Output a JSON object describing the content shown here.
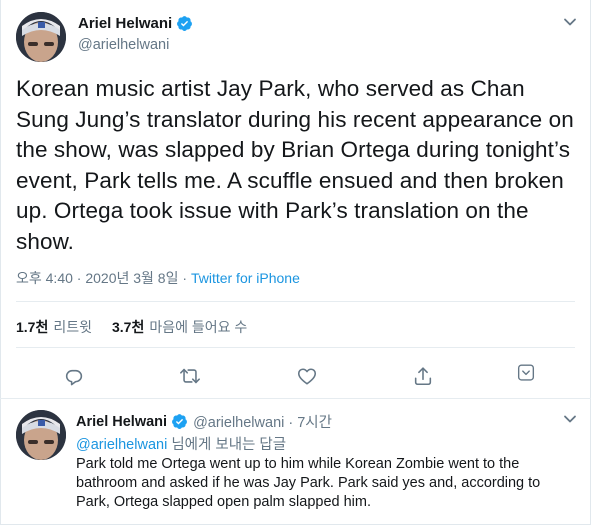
{
  "tweet": {
    "author_name": "Ariel Helwani",
    "author_handle": "@arielhelwani",
    "text": "Korean music artist Jay Park, who served as Chan Sung Jung’s translator during his recent appearance on the show, was slapped by Brian Ortega during tonight’s event, Park tells me. A scuffle ensued and then broken up. Ortega took issue with Park’s translation on the show.",
    "timestamp": "오후 4:40 · 2020년 3월 8일",
    "separator": " · ",
    "source": "Twitter for iPhone",
    "retweets": {
      "count": "1.7천",
      "label": "리트윗"
    },
    "likes": {
      "count": "3.7천",
      "label": "마음에 들어요 수"
    }
  },
  "reply": {
    "author_name": "Ariel Helwani",
    "author_handle": "@arielhelwani · 7시간",
    "reply_to_mention": "@arielhelwani",
    "reply_to_suffix": " 님에게 보내는 답글",
    "text": "Park told me Ortega went up to him while Korean Zombie went to the bathroom and asked if he was Jay Park. Park said yes and, according to Park, Ortega slapped open palm slapped him."
  },
  "icons": {
    "verified": "verified-badge-icon",
    "caret": "chevron-down-icon",
    "reply": "reply-icon",
    "retweet": "retweet-icon",
    "like": "heart-icon",
    "share": "share-icon",
    "analytics": "analytics-icon"
  },
  "colors": {
    "accent": "#1b95e0",
    "secondary_text": "#657786",
    "primary_text": "#14171a",
    "verified": "#1da1f2"
  }
}
